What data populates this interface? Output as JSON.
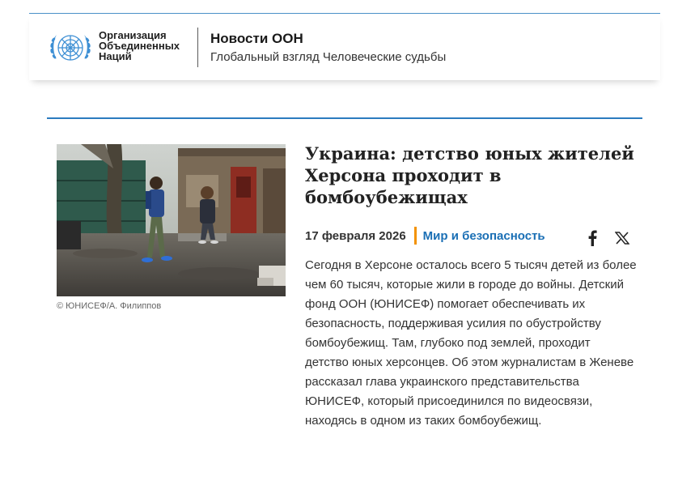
{
  "header": {
    "org_name_lines": [
      "Организация",
      "Объединенных",
      "Наций"
    ],
    "title": "Новости ООН",
    "subtitle": "Глобальный взгляд Человеческие судьбы",
    "accent_color": "#2b7bbf"
  },
  "article": {
    "photo_caption": "© ЮНИСЕФ/А. Филиппов",
    "headline": "Украина: детство юных жителей Херсона проходит в бомбоубежищах",
    "date": "17 февраля 2026",
    "category": "Мир и безопасность",
    "summary": "Сегодня в Херсоне осталось всего 5 тысяч детей из более чем 60 тысяч, которые жили в городе до войны. Детский фонд ООН (ЮНИСЕФ) помогает обеспечивать их безопасность, поддерживая усилия по обустройству бомбоубежищ. Там, глубоко под землей, проходит детство юных херсонцев. Об этом журналистам в Женеве рассказал глава украинского представительства ЮНИСЕФ, который присоединился по видеосвязи, находясь в одном из таких бомбоубежищ.",
    "share": {
      "facebook_icon": "facebook-icon",
      "x_icon": "x-icon"
    }
  },
  "colors": {
    "category_link": "#1a6fb5",
    "separator_orange": "#f39200",
    "un_blue": "#3d8fd4"
  }
}
